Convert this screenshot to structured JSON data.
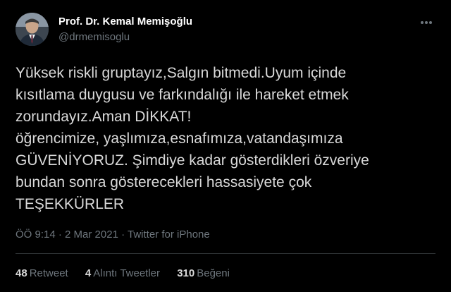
{
  "author": {
    "name": "Prof. Dr. Kemal Memişoğlu",
    "handle": "@drmemisoglu"
  },
  "tweet": {
    "text": "Yüksek riskli gruptayız,Salgın bitmedi.Uyum içinde\nkısıtlama duygusu ve farkındalığı ile hareket etmek\nzorundayız.Aman DİKKAT!\nöğrencimize, yaşlımıza,esnafımıza,vatandaşımıza\nGÜVENİYORUZ. Şimdiye kadar gösterdikleri özveriye\nbundan sonra gösterecekleri hassasiyete çok\nTEŞEKKÜRLER"
  },
  "meta": {
    "time": "ÖÖ 9:14",
    "separator": " · ",
    "date": "2 Mar 2021",
    "source": "Twitter for iPhone"
  },
  "stats": [
    {
      "count": "48",
      "label": "Retweet"
    },
    {
      "count": "4",
      "label": "Alıntı Tweetler"
    },
    {
      "count": "310",
      "label": "Beğeni"
    }
  ],
  "icons": {
    "more": "more-horizontal-icon",
    "avatar": "profile-photo"
  },
  "colors": {
    "background": "#000000",
    "text": "#d9d9d9",
    "name": "#ffffff",
    "muted": "#6e767d",
    "divider": "#2f3336"
  }
}
